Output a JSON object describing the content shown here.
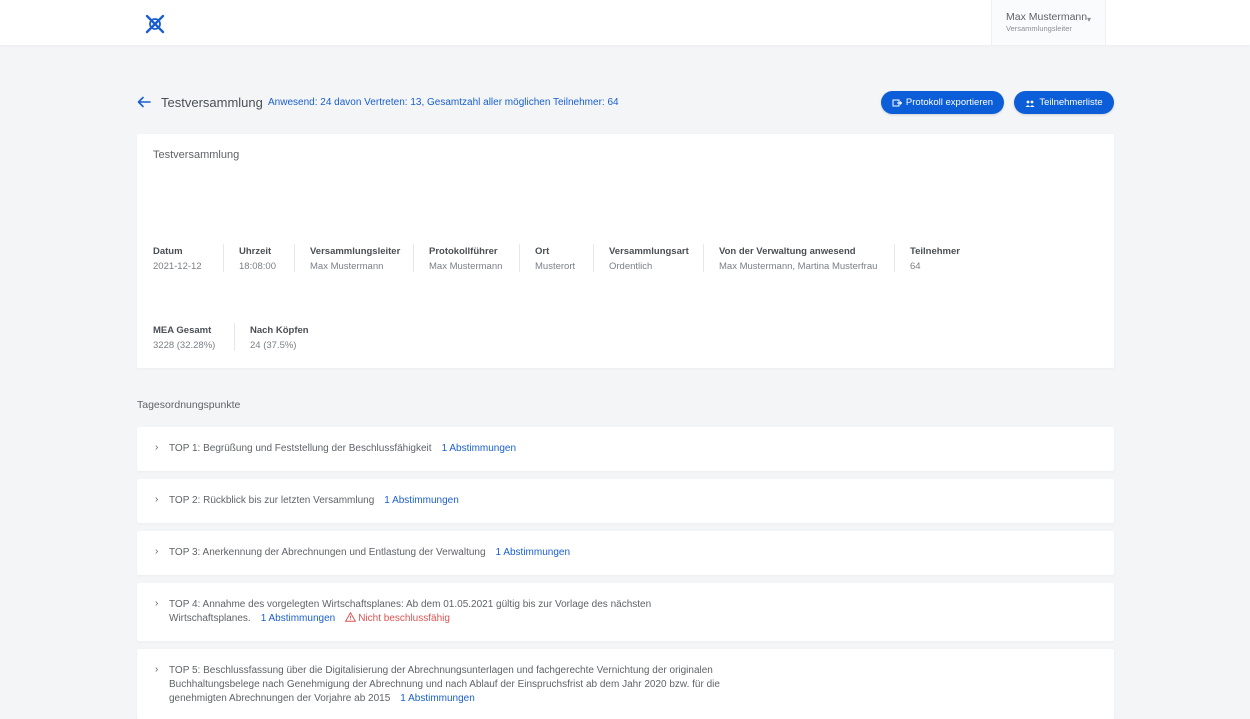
{
  "header": {
    "user_name": "Max Mustermann",
    "user_role": "Versammlungsleiter"
  },
  "page": {
    "title": "Testversammlung",
    "attendance": "Anwesend: 24 davon Vertreten: 13, Gesamtzahl aller möglichen Teilnehmer: 64",
    "export_label": "Protokoll exportieren",
    "participants_label": "Teilnehmerliste"
  },
  "details": {
    "title": "Testversammlung",
    "fields": [
      {
        "label": "Datum",
        "value": "2021-12-12"
      },
      {
        "label": "Uhrzeit",
        "value": "18:08:00"
      },
      {
        "label": "Versammlungsleiter",
        "value": "Max Mustermann"
      },
      {
        "label": "Protokollführer",
        "value": "Max Mustermann"
      },
      {
        "label": "Ort",
        "value": "Musterort"
      },
      {
        "label": "Versammlungsart",
        "value": "Ordentlich"
      },
      {
        "label": "Von der Verwaltung anwesend",
        "value": "Max Mustermann, Martina Musterfrau"
      },
      {
        "label": "Teilnehmer",
        "value": "64"
      },
      {
        "label": "MEA Gesamt",
        "value": "3228 (32.28%)"
      },
      {
        "label": "Nach Köpfen",
        "value": "24 (37.5%)"
      }
    ]
  },
  "agenda": {
    "section_title": "Tagesordnungspunkte",
    "items": [
      {
        "text": "TOP 1: Begrüßung und Feststellung der Beschlussfähigkeit",
        "votes": "1 Abstimmungen"
      },
      {
        "text": "TOP 2: Rückblick bis zur letzten Versammlung",
        "votes": "1 Abstimmungen"
      },
      {
        "text": "TOP 3: Anerkennung der Abrechnungen und Entlastung der Verwaltung",
        "votes": "1 Abstimmungen"
      },
      {
        "text_line1": "TOP 4: Annahme des vorgelegten Wirtschaftsplanes: Ab dem 01.05.2021 gültig bis zur Vorlage des nächsten",
        "text_line2": "Wirtschaftsplanes.",
        "votes": "1 Abstimmungen",
        "warning": "Nicht beschlussfähig"
      },
      {
        "text_line1": "TOP 5: Beschlussfassung über die Digitalisierung der Abrechnungsunterlagen und fachgerechte Vernichtung der originalen",
        "text_line2": "Buchhaltungsbelege nach Genehmigung der Abrechnung und nach Ablauf der Einspruchsfrist ab dem Jahr 2020 bzw. für die",
        "text_line3": "genehmigten Abrechnungen der Vorjahre ab 2015",
        "votes": "1 Abstimmungen"
      }
    ]
  },
  "colors": {
    "primary": "#0b5ed7",
    "link": "#1a5fd0",
    "warning": "#e05252",
    "background": "#f4f5f7"
  }
}
